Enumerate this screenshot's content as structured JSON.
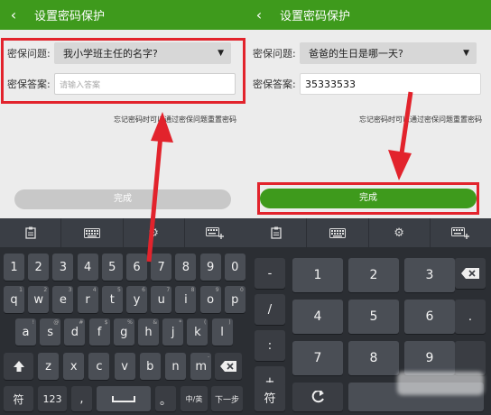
{
  "colors": {
    "accent": "#3e9a1c",
    "highlight": "#e2232c"
  },
  "left": {
    "title": "设置密码保护",
    "back_icon": "back-chevron-icon",
    "question_label": "密保问题:",
    "question_value": "我小学班主任的名字?",
    "answer_label": "密保答案:",
    "answer_placeholder": "请输入答案",
    "hint": "忘记密码时可以通过密保问题重置密码",
    "done_label": "完成",
    "toolbar_icons": [
      "clipboard-icon",
      "keyboard-icon",
      "gear-icon",
      "keyboard-settings-icon"
    ],
    "rows": [
      [
        "1",
        "2",
        "3",
        "4",
        "5",
        "6",
        "7",
        "8",
        "9",
        "0"
      ],
      [
        "q",
        "w",
        "e",
        "r",
        "t",
        "y",
        "u",
        "i",
        "o",
        "p"
      ],
      [
        "a",
        "s",
        "d",
        "f",
        "g",
        "h",
        "j",
        "k",
        "l"
      ],
      [
        "z",
        "x",
        "c",
        "v",
        "b",
        "n",
        "m"
      ]
    ],
    "row_subs": [
      [
        "",
        "",
        "",
        "",
        "",
        "",
        "",
        "",
        "",
        ""
      ],
      [
        "1",
        "2",
        "3",
        "4",
        "5",
        "6",
        "7",
        "8",
        "9",
        "0"
      ],
      [
        "!",
        "@",
        "#",
        "$",
        "%",
        "&",
        "*",
        "(",
        ")"
      ],
      [
        "",
        "",
        "",
        "",
        "",
        "",
        "-"
      ]
    ],
    "sym_key": "符",
    "num_key": "123",
    "comma_key": ",",
    "period_key": "。",
    "lang_key": "中/英",
    "next_key": "下一步"
  },
  "right": {
    "title": "设置密码保护",
    "back_icon": "back-chevron-icon",
    "question_label": "密保问题:",
    "question_value": "爸爸的生日是哪一天?",
    "answer_label": "密保答案:",
    "answer_value": "35333533",
    "hint": "忘记密码时可以通过密保问题重置密码",
    "done_label": "完成",
    "toolbar_icons": [
      "clipboard-icon",
      "keyboard-icon",
      "gear-icon",
      "keyboard-settings-icon"
    ],
    "side_keys": [
      "-",
      "/",
      ":",
      "+"
    ],
    "digit_rows": [
      [
        "1",
        "2",
        "3"
      ],
      [
        "4",
        "5",
        "6"
      ],
      [
        "7",
        "8",
        "9"
      ]
    ],
    "right_keys": [
      "backspace-icon",
      ".",
      ""
    ],
    "sym_key": "符",
    "enter_icon": "enter-icon"
  }
}
